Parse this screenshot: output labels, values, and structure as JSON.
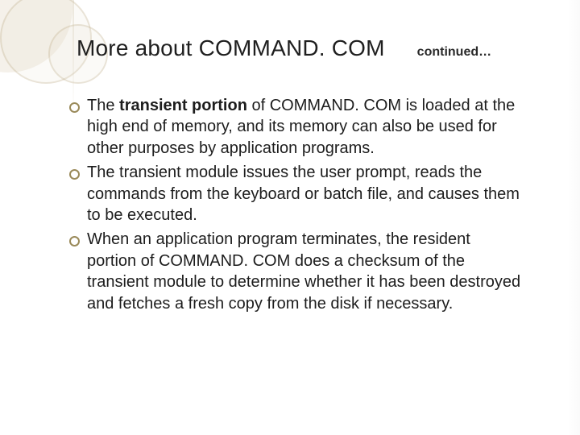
{
  "header": {
    "title": "More about COMMAND. COM",
    "continued": "continued…"
  },
  "bullets": [
    {
      "pre": "The ",
      "bold": "transient portion",
      "post": " of COMMAND. COM is loaded at the high end of memory, and its memory can also be used for other purposes by application programs."
    },
    {
      "text": "The transient module issues the user prompt, reads the commands from the keyboard or batch file, and causes them to be executed."
    },
    {
      "text": "When an application program terminates, the resident portion of COMMAND. COM does a checksum of the transient module to determine whether it has been destroyed and fetches a fresh copy from the disk if necessary."
    }
  ]
}
